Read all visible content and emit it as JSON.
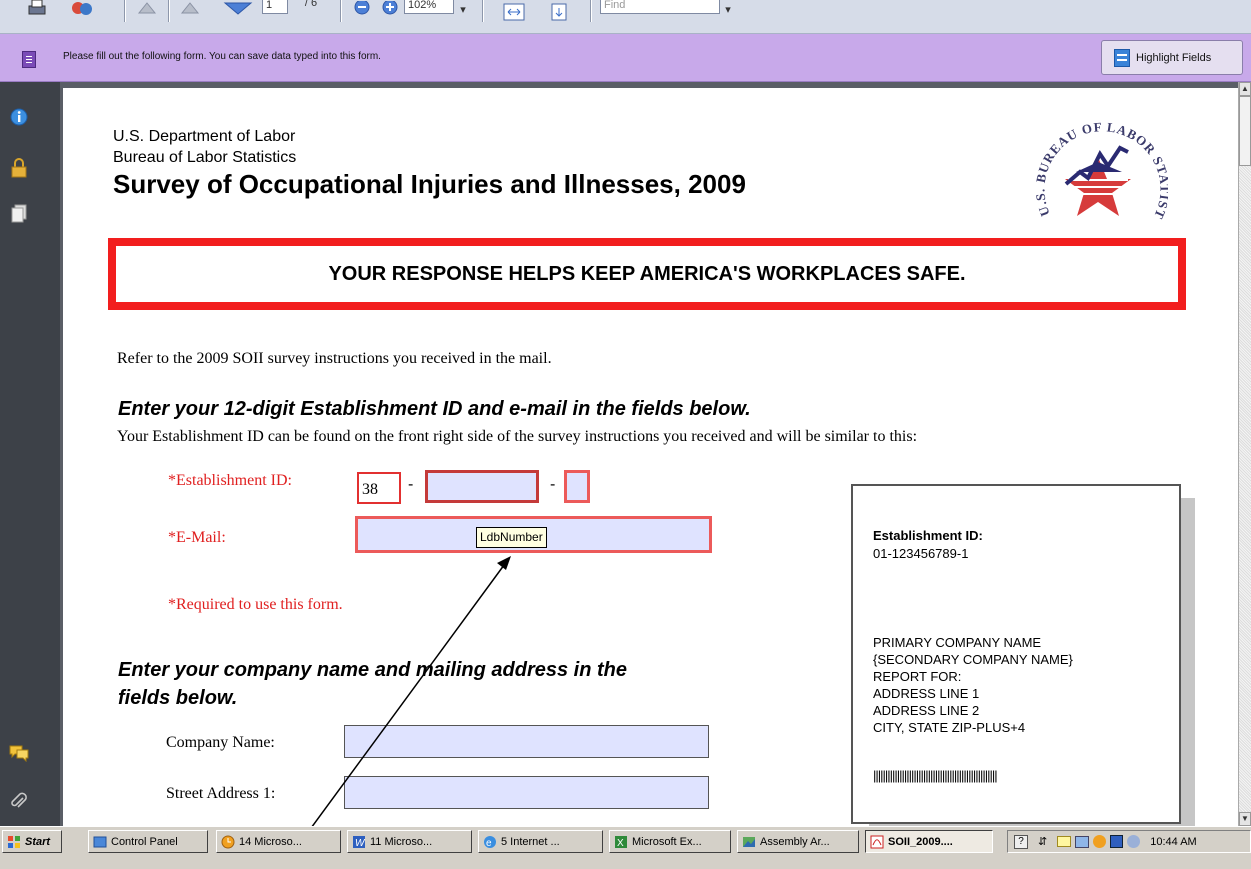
{
  "toolbar": {
    "page_number": "1",
    "page_total": "/ 6",
    "zoom": "102%",
    "find_placeholder": "Find"
  },
  "message_bar": {
    "text": "Please fill out the following form. You can save data typed into this form.",
    "highlight_button": "Highlight Fields"
  },
  "header": {
    "dept": "U.S. Department of Labor",
    "bureau": "Bureau of Labor Statistics",
    "title": "Survey of Occupational Injuries and Illnesses, 2009",
    "seal_text": "U.S. BUREAU OF LABOR STATISTICS"
  },
  "banner": "YOUR RESPONSE HELPS KEEP AMERICA'S WORKPLACES SAFE.",
  "refer_text": "Refer to the 2009 SOII survey instructions you received in the mail.",
  "section1": {
    "heading": "Enter your 12-digit Establishment ID and e-mail in the fields below.",
    "subtext": "Your Establishment ID can be found on the front right side of the survey instructions you received and will be similar to this:"
  },
  "form": {
    "estab_label": "*Establishment ID:",
    "estab_part1": "38",
    "dash": "-",
    "email_label": "*E-Mail:",
    "tooltip": "LdbNumber",
    "required": "*Required to use this form.",
    "company_label": "Company Name:",
    "street1_label": "Street Address 1:"
  },
  "section2": {
    "heading_line1": "Enter your company name and mailing address in the",
    "heading_line2": "fields below."
  },
  "sample_label": {
    "estab_title": "Establishment ID:",
    "estab_value": "01-123456789-1",
    "lines": [
      "PRIMARY COMPANY NAME",
      "{SECONDARY COMPANY NAME}",
      "REPORT FOR:",
      "ADDRESS LINE 1",
      "ADDRESS LINE 2",
      "CITY, STATE  ZIP-PLUS+4"
    ],
    "barcode": "||||||||||||||||||||||||||||||||||||||||||||||||||||"
  },
  "taskbar": {
    "start": "Start",
    "items": [
      {
        "label": "Control Panel"
      },
      {
        "label": "14 Microso..."
      },
      {
        "label": "11 Microso..."
      },
      {
        "label": "5 Internet ..."
      },
      {
        "label": "Microsoft Ex..."
      },
      {
        "label": "Assembly Ar..."
      },
      {
        "label": "SOII_2009...."
      }
    ],
    "clock": "10:44 AM"
  }
}
